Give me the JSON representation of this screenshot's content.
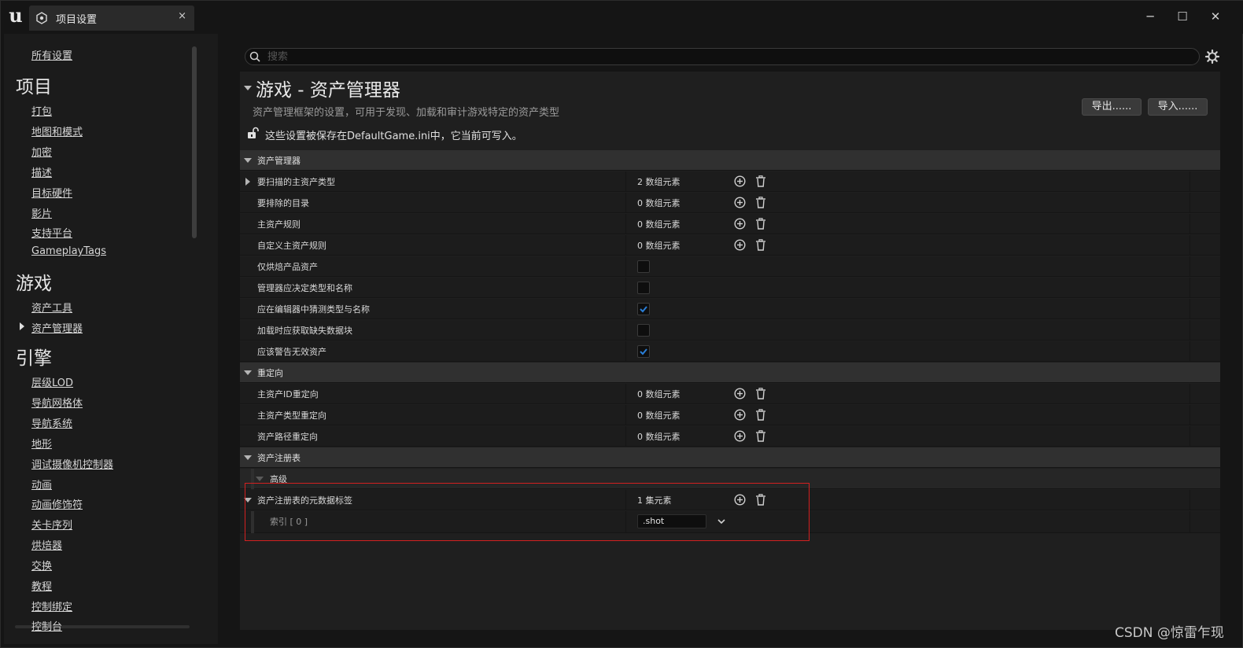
{
  "titlebar": {
    "tab_label": "项目设置",
    "tab_close": "×",
    "minimize": "─",
    "maximize": "☐",
    "close": "✕"
  },
  "sidebar": {
    "all_settings": "所有设置",
    "sections": [
      {
        "title": "项目",
        "items": [
          "打包",
          "地图和模式",
          "加密",
          "描述",
          "目标硬件",
          "影片",
          "支持平台",
          "GameplayTags"
        ]
      },
      {
        "title": "游戏",
        "items": [
          "资产工具",
          "资产管理器"
        ]
      },
      {
        "title": "引擎",
        "items": [
          "层级LOD",
          "导航网格体",
          "导航系统",
          "地形",
          "调试摄像机控制器",
          "动画",
          "动画修饰符",
          "关卡序列",
          "烘焙器",
          "交换",
          "教程",
          "控制绑定",
          "控制台"
        ]
      }
    ],
    "active_item": "资产管理器"
  },
  "search": {
    "placeholder": "搜索"
  },
  "page": {
    "title": "游戏 - 资产管理器",
    "description": "资产管理框架的设置，可用于发现、加载和审计游戏特定的资产类型",
    "export_label": "导出......",
    "import_label": "导入......",
    "save_notice": "这些设置被保存在DefaultGame.ini中，它当前可写入。"
  },
  "rows": [
    {
      "kind": "cat",
      "label": "资产管理器"
    },
    {
      "kind": "array",
      "label": "要扫描的主资产类型",
      "value": "2 数组元素",
      "expand": true
    },
    {
      "kind": "array",
      "label": "要排除的目录",
      "value": "0 数组元素"
    },
    {
      "kind": "array",
      "label": "主资产规则",
      "value": "0 数组元素"
    },
    {
      "kind": "array",
      "label": "自定义主资产规则",
      "value": "0 数组元素"
    },
    {
      "kind": "check",
      "label": "仅烘焙产品资产",
      "checked": false
    },
    {
      "kind": "check",
      "label": "管理器应决定类型和名称",
      "checked": false
    },
    {
      "kind": "check",
      "label": "应在编辑器中猜测类型与名称",
      "checked": true
    },
    {
      "kind": "check",
      "label": "加载时应获取缺失数据块",
      "checked": false
    },
    {
      "kind": "check",
      "label": "应该警告无效资产",
      "checked": true
    },
    {
      "kind": "cat",
      "label": "重定向"
    },
    {
      "kind": "array",
      "label": "主资产ID重定向",
      "value": "0 数组元素"
    },
    {
      "kind": "array",
      "label": "主资产类型重定向",
      "value": "0 数组元素"
    },
    {
      "kind": "array",
      "label": "资产路径重定向",
      "value": "0 数组元素"
    },
    {
      "kind": "cat",
      "label": "资产注册表"
    },
    {
      "kind": "sub",
      "label": "高级"
    },
    {
      "kind": "set",
      "label": "资产注册表的元数据标签",
      "value": "1 集元素"
    },
    {
      "kind": "element",
      "label": "索引 [ 0 ]",
      "value": ".shot"
    }
  ],
  "watermark": "CSDN @惊雷乍现",
  "colors": {
    "checkbox_accent": "#2a7fd8",
    "highlight": "#d32020"
  }
}
